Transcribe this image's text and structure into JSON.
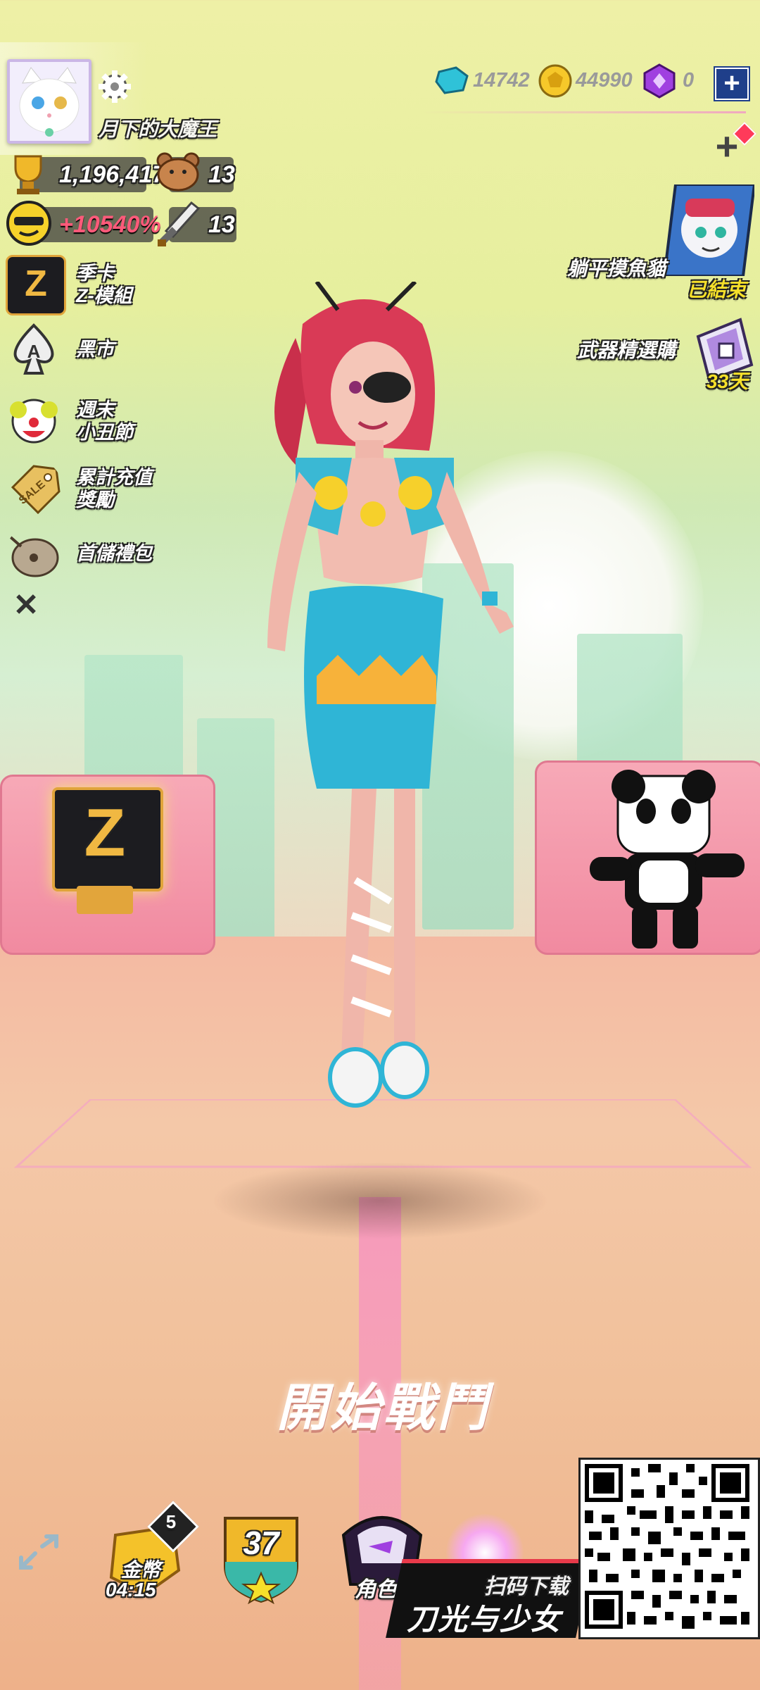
{
  "player": {
    "name": "月下的大魔王"
  },
  "stats": {
    "trophies": "1,196,417",
    "bear_count": "13",
    "bonus": "+10540%",
    "sword_count": "13"
  },
  "currency": {
    "diamonds": "14742",
    "coins": "44990",
    "crystals": "0"
  },
  "left_menu": [
    {
      "icon": "z-card-icon",
      "label": "季卡\nZ-模組"
    },
    {
      "icon": "spade-icon",
      "label": "黑市"
    },
    {
      "icon": "clown-icon",
      "label": "週末\n小丑節"
    },
    {
      "icon": "sale-tag-icon",
      "label": "累計充值\n獎勵"
    },
    {
      "icon": "gift-pouch-icon",
      "label": "首儲禮包"
    }
  ],
  "right_events": [
    {
      "label": "躺平摸魚貓",
      "status": "已結束"
    },
    {
      "label": "武器精選購",
      "status": "33天"
    }
  ],
  "start_button": "開始戰鬥",
  "bottom_bar": {
    "coin_label": "金幣",
    "coin_timer": "04:15",
    "coin_badge": "5",
    "level": "37",
    "role_label": "角色"
  },
  "promo": {
    "scan": "扫码下载",
    "game_title": "刀光与少女"
  },
  "z_box_letter": "Z",
  "colors": {
    "accent_red": "#ff4a6a",
    "hair": "#d93a56",
    "teal": "#2fb5d6"
  }
}
